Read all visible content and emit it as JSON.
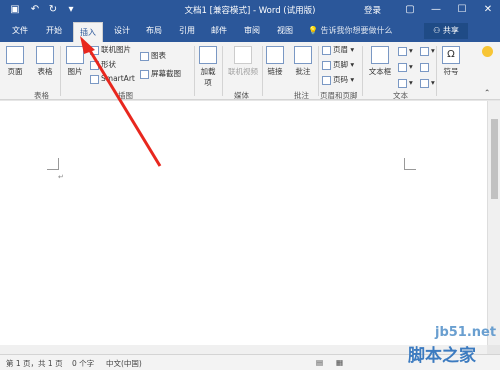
{
  "titlebar": {
    "title": "文档1 [兼容模式] - Word (试用版)",
    "login": "登录",
    "icons": [
      "save-icon",
      "undo-icon",
      "redo-icon",
      "customize-icon"
    ],
    "restore_icon": "▢",
    "minimize": "—",
    "maximize": "☐",
    "close": "✕"
  },
  "tabs": [
    "文件",
    "开始",
    "插入",
    "设计",
    "布局",
    "引用",
    "邮件",
    "审阅",
    "视图"
  ],
  "active_tab": "插入",
  "tell_me": "告诉我你想要做什么",
  "share": "共享",
  "ribbon": {
    "page": "页面",
    "table": "表格",
    "picture": "图片",
    "online_picture": "联机图片",
    "shapes": "形状",
    "smartart": "SmartArt",
    "chart": "图表",
    "screenshot": "屏幕截图",
    "addins": "加载项",
    "online_video": "联机视频",
    "link": "链接",
    "comment": "批注",
    "header": "页眉",
    "footer": "页脚",
    "page_number": "页码",
    "textbox": "文本框",
    "symbol": "符号",
    "groups": {
      "table": "表格",
      "illustrations": "插图",
      "media": "媒体",
      "comments": "批注",
      "header_footer": "页眉和页脚",
      "text": "文本"
    }
  },
  "document": {
    "paragraph_mark": "↵"
  },
  "statusbar": {
    "page": "第 1 页，共 1 页",
    "words": "0 个字",
    "language": "中文(中国)"
  },
  "watermark": {
    "line1": "jb51.net",
    "line2": "脚本之家"
  },
  "colors": {
    "brand": "#2b579a",
    "arrow": "#e8271e"
  }
}
